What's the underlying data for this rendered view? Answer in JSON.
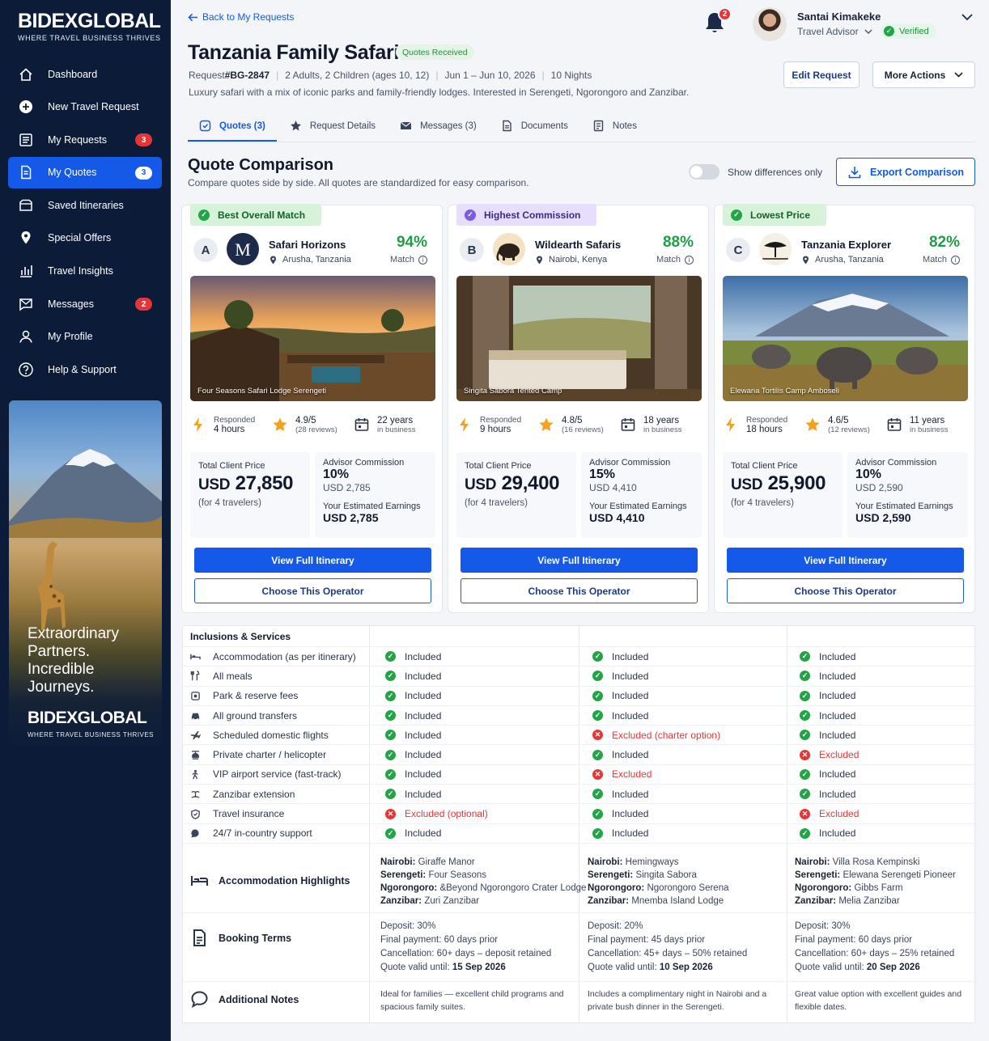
{
  "brand": {
    "name": "BIDEXGLOBAL",
    "tagline": "WHERE TRAVEL BUSINESS THRIVES"
  },
  "nav": [
    {
      "label": "Dashboard",
      "icon": "home-icon",
      "badge": ""
    },
    {
      "label": "New Travel Request",
      "icon": "plus-circle-icon",
      "badge": ""
    },
    {
      "label": "My Requests",
      "icon": "list-icon",
      "badge": "3"
    },
    {
      "label": "My Quotes",
      "icon": "document-icon",
      "badge": "3",
      "active": true
    },
    {
      "label": "Saved Itineraries",
      "icon": "folder-icon",
      "badge": ""
    },
    {
      "label": "Special Offers",
      "icon": "tag-icon",
      "badge": ""
    },
    {
      "label": "Travel Insights",
      "icon": "chart-icon",
      "badge": ""
    },
    {
      "label": "Messages",
      "icon": "mail-icon",
      "badge": "2"
    },
    {
      "label": "My Profile",
      "icon": "user-icon",
      "badge": ""
    },
    {
      "label": "Help & Support",
      "icon": "help-icon",
      "badge": ""
    }
  ],
  "promo": {
    "headline_lines": [
      "Extraordinary",
      "Partners.",
      "Incredible",
      "Journeys."
    ],
    "brand": "BIDEXGLOBAL",
    "tagline": "WHERE TRAVEL BUSINESS THRIVES"
  },
  "header": {
    "back_label": "Back to My Requests",
    "notification_count": "2",
    "user_name": "Santai Kimakeke",
    "user_role": "Travel Advisor",
    "verified_label": "Verified"
  },
  "request": {
    "title": "Tanzania Family Safari",
    "status": "Quotes Received",
    "id_prefix": "Request ",
    "id": "#BG-2847",
    "travelers": "2 Adults, 2 Children (ages 10, 12)",
    "dates": "Jun 1 – Jun 10, 2026",
    "nights": "10 Nights",
    "description": "Luxury safari with a mix of iconic parks and family-friendly lodges. Interested in Serengeti, Ngorongoro and Zanzibar.",
    "edit_label": "Edit Request",
    "more_label": "More Actions"
  },
  "tabs": [
    {
      "label": "Quotes (3)",
      "icon": "quote-icon",
      "active": true
    },
    {
      "label": "Request Details",
      "icon": "sparkle-icon"
    },
    {
      "label": "Messages (3)",
      "icon": "mail-icon"
    },
    {
      "label": "Documents",
      "icon": "file-icon"
    },
    {
      "label": "Notes",
      "icon": "notes-icon"
    }
  ],
  "comparison": {
    "title": "Quote Comparison",
    "subtitle": "Compare quotes side by side. All quotes are standardized for easy comparison.",
    "toggle_label": "Show differences only",
    "export_label": "Export Comparison"
  },
  "quotes": [
    {
      "ribbon": "Best Overall Match",
      "ribbon_color": "#d6f2d9",
      "ribbon_text": "#15612c",
      "ribbon_icon_bg": "#22a447",
      "letter": "A",
      "operator": "Safari Horizons",
      "location": "Arusha, Tanzania",
      "match": "94%",
      "match_label": "Match",
      "photo_caption": "Four Seasons Safari Lodge Serengeti",
      "responded_label": "Responded",
      "responded": "4 hours",
      "rating": "4.9/5",
      "reviews": "(28 reviews)",
      "years": "22 years",
      "years_label": "in business",
      "price_label": "Total Client Price",
      "currency": "USD",
      "price": "27,850",
      "price_note": "(for 4 travelers)",
      "commission_label": "Advisor Commission",
      "commission_pct": "10%",
      "commission_amt": "USD 2,785",
      "earnings_label": "Your Estimated Earnings",
      "earnings": "USD 2,785",
      "view_label": "View Full Itinerary",
      "choose_label": "Choose This Operator"
    },
    {
      "ribbon": "Highest Commission",
      "ribbon_color": "#e6defa",
      "ribbon_text": "#3d2a86",
      "ribbon_icon_bg": "#7b5ce0",
      "letter": "B",
      "operator": "Wildearth Safaris",
      "location": "Nairobi, Kenya",
      "match": "88%",
      "match_label": "Match",
      "photo_caption": "Singita Sabora Tented Camp",
      "responded_label": "Responded",
      "responded": "9 hours",
      "rating": "4.8/5",
      "reviews": "(16 reviews)",
      "years": "18 years",
      "years_label": "in business",
      "price_label": "Total Client Price",
      "currency": "USD",
      "price": "29,400",
      "price_note": "(for 4 travelers)",
      "commission_label": "Advisor Commission",
      "commission_pct": "15%",
      "commission_amt": "USD 4,410",
      "earnings_label": "Your Estimated Earnings",
      "earnings": "USD 4,410",
      "view_label": "View Full Itinerary",
      "choose_label": "Choose This Operator"
    },
    {
      "ribbon": "Lowest Price",
      "ribbon_color": "#d6f2d9",
      "ribbon_text": "#15612c",
      "ribbon_icon_bg": "#22a447",
      "letter": "C",
      "operator": "Tanzania Explorer",
      "location": "Arusha, Tanzania",
      "match": "82%",
      "match_label": "Match",
      "photo_caption": "Elewana Tortilis Camp Amboseli",
      "responded_label": "Responded",
      "responded": "18 hours",
      "rating": "4.6/5",
      "reviews": "(12 reviews)",
      "years": "11 years",
      "years_label": "in business",
      "price_label": "Total Client Price",
      "currency": "USD",
      "price": "25,900",
      "price_note": "(for 4 travelers)",
      "commission_label": "Advisor Commission",
      "commission_pct": "10%",
      "commission_amt": "USD 2,590",
      "earnings_label": "Your Estimated Earnings",
      "earnings": "USD 2,590",
      "view_label": "View Full Itinerary",
      "choose_label": "Choose This Operator"
    }
  ],
  "inclusions": {
    "header": "Inclusions & Services",
    "rows": [
      {
        "feature": "Accommodation (as per itinerary)",
        "icon": "bed-icon",
        "values": [
          [
            "in",
            "Included"
          ],
          [
            "in",
            "Included"
          ],
          [
            "in",
            "Included"
          ]
        ]
      },
      {
        "feature": "All meals",
        "icon": "utensils-icon",
        "values": [
          [
            "in",
            "Included"
          ],
          [
            "in",
            "Included"
          ],
          [
            "in",
            "Included"
          ]
        ]
      },
      {
        "feature": "Park & reserve fees",
        "icon": "ticket-icon",
        "values": [
          [
            "in",
            "Included"
          ],
          [
            "in",
            "Included"
          ],
          [
            "in",
            "Included"
          ]
        ]
      },
      {
        "feature": "All ground transfers",
        "icon": "car-icon",
        "values": [
          [
            "in",
            "Included"
          ],
          [
            "in",
            "Included"
          ],
          [
            "in",
            "Included"
          ]
        ]
      },
      {
        "feature": "Scheduled domestic flights",
        "icon": "plane-icon",
        "values": [
          [
            "in",
            "Included"
          ],
          [
            "ex",
            "Excluded (charter option)"
          ],
          [
            "in",
            "Included"
          ]
        ]
      },
      {
        "feature": "Private charter / helicopter",
        "icon": "helicopter-icon",
        "values": [
          [
            "in",
            "Included"
          ],
          [
            "in",
            "Included"
          ],
          [
            "ex",
            "Excluded"
          ]
        ]
      },
      {
        "feature": "VIP airport service (fast-track)",
        "icon": "fasttrack-icon",
        "values": [
          [
            "in",
            "Included"
          ],
          [
            "ex",
            "Excluded"
          ],
          [
            "in",
            "Included"
          ]
        ]
      },
      {
        "feature": "Zanzibar extension",
        "icon": "island-icon",
        "values": [
          [
            "in",
            "Included"
          ],
          [
            "in",
            "Included"
          ],
          [
            "in",
            "Included"
          ]
        ]
      },
      {
        "feature": "Travel insurance",
        "icon": "shield-icon",
        "values": [
          [
            "ex",
            "Excluded (optional)"
          ],
          [
            "in",
            "Included"
          ],
          [
            "ex",
            "Excluded"
          ]
        ]
      },
      {
        "feature": "24/7 in-country support",
        "icon": "chat-icon",
        "values": [
          [
            "in",
            "Included"
          ],
          [
            "in",
            "Included"
          ],
          [
            "in",
            "Included"
          ]
        ]
      }
    ]
  },
  "accommodation": {
    "title": "Accommodation Highlights",
    "columns": [
      [
        [
          "Nairobi:",
          "Giraffe Manor"
        ],
        [
          "Serengeti:",
          "Four Seasons"
        ],
        [
          "Ngorongoro:",
          "&Beyond Ngorongoro Crater Lodge"
        ],
        [
          "Zanzibar:",
          "Zuri Zanzibar"
        ]
      ],
      [
        [
          "Nairobi:",
          "Hemingways"
        ],
        [
          "Serengeti:",
          "Singita Sabora"
        ],
        [
          "Ngorongoro:",
          "Ngorongoro Serena"
        ],
        [
          "Zanzibar:",
          "Mnemba Island Lodge"
        ]
      ],
      [
        [
          "Nairobi:",
          "Villa Rosa Kempinski"
        ],
        [
          "Serengeti:",
          "Elewana Serengeti Pioneer"
        ],
        [
          "Ngorongoro:",
          "Gibbs Farm"
        ],
        [
          "Zanzibar:",
          "Melia Zanzibar"
        ]
      ]
    ]
  },
  "booking": {
    "title": "Booking Terms",
    "valid_label": "Quote valid until: ",
    "columns": [
      {
        "lines": [
          "Deposit: 30%",
          "Final payment: 60 days prior",
          "Cancellation: 60+ days – deposit retained"
        ],
        "valid": "15 Sep 2026"
      },
      {
        "lines": [
          "Deposit: 20%",
          "Final payment: 45 days prior",
          "Cancellation: 45+ days – 50% retained"
        ],
        "valid": "10 Sep 2026"
      },
      {
        "lines": [
          "Deposit: 30%",
          "Final payment: 60 days prior",
          "Cancellation: 60+ days – 25% retained"
        ],
        "valid": "20 Sep 2026"
      }
    ]
  },
  "notes": {
    "title": "Additional Notes",
    "columns": [
      [
        "Ideal for families — excellent child programs and",
        "spacious family suites."
      ],
      [
        "Includes a complimentary night in Nairobi and a",
        "private bush dinner in the Serengeti."
      ],
      [
        "Great value option with excellent guides and",
        "flexible dates."
      ]
    ]
  }
}
